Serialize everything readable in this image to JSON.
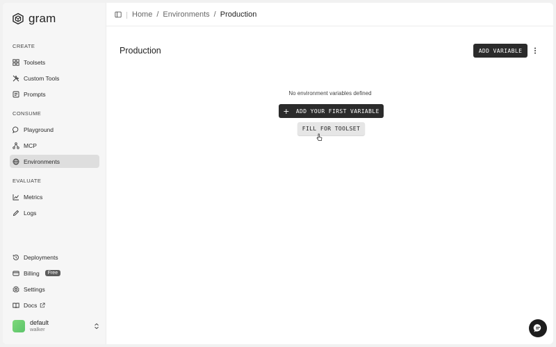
{
  "app": {
    "name": "gram"
  },
  "sidebar": {
    "sections": [
      {
        "label": "CREATE",
        "items": [
          {
            "label": "Toolsets",
            "icon": "toolsets-icon"
          },
          {
            "label": "Custom Tools",
            "icon": "custom-tools-icon"
          },
          {
            "label": "Prompts",
            "icon": "prompts-icon"
          }
        ]
      },
      {
        "label": "CONSUME",
        "items": [
          {
            "label": "Playground",
            "icon": "chat-bubble-icon"
          },
          {
            "label": "MCP",
            "icon": "network-icon"
          },
          {
            "label": "Environments",
            "icon": "globe-icon",
            "active": true
          }
        ]
      },
      {
        "label": "EVALUATE",
        "items": [
          {
            "label": "Metrics",
            "icon": "chart-icon"
          },
          {
            "label": "Logs",
            "icon": "pencil-icon"
          }
        ]
      }
    ],
    "bottom_items": [
      {
        "label": "Deployments",
        "icon": "history-icon"
      },
      {
        "label": "Billing",
        "icon": "card-icon",
        "badge": "Free"
      },
      {
        "label": "Settings",
        "icon": "gear-icon"
      },
      {
        "label": "Docs",
        "icon": "book-icon"
      }
    ],
    "account": {
      "name": "default",
      "sub": "walker",
      "color": "#6fd072"
    }
  },
  "breadcrumb": {
    "items": [
      "Home",
      "Environments",
      "Production"
    ],
    "separator": "/"
  },
  "page": {
    "title": "Production",
    "add_variable_label": "ADD VARIABLE",
    "empty_message": "No environment variables defined",
    "add_first_label": "ADD YOUR FIRST VARIABLE",
    "fill_toolset_label": "FILL FOR TOOLSET"
  },
  "colors": {
    "primary_button": "#2b2b2b",
    "active_nav": "#dedede",
    "secondary_button": "#e6e6e6"
  }
}
